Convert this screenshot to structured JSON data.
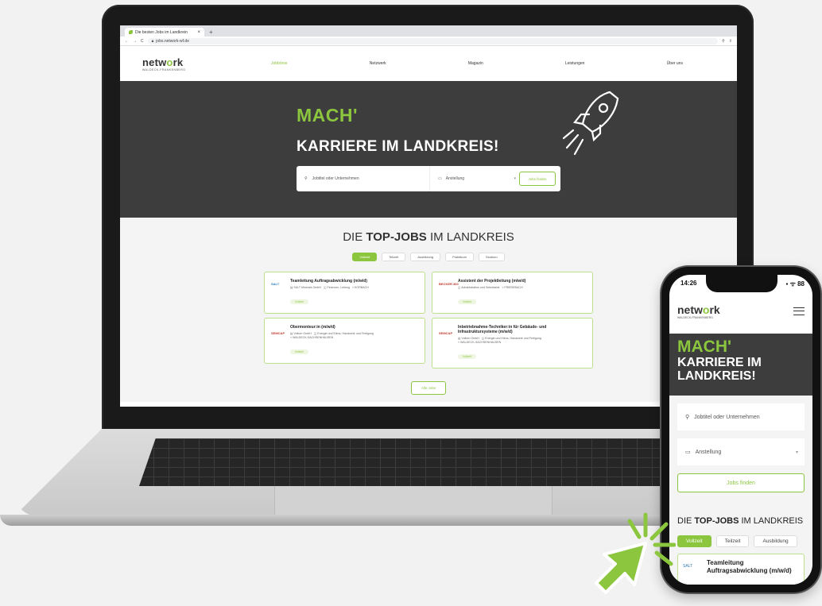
{
  "browser": {
    "tab_title": "Die besten Jobs im Landkrein",
    "tab_close": "×",
    "new_tab": "+",
    "url": "jobs.network-wf.de"
  },
  "site": {
    "logo_main_a": "netw",
    "logo_main_o": "o",
    "logo_main_b": "rk",
    "logo_sub": "WALDECK-FRANKENBERG",
    "nav": [
      "Jobbörse",
      "Netzwerk",
      "Magazin",
      "Leistungen",
      "Über uns"
    ]
  },
  "hero": {
    "mach": "MACH'",
    "title": "KARRIERE IM LANDKREIS!",
    "search_placeholder": "Jobtitel oder Unternehmen",
    "select_value": "Anstellung",
    "button": "Jobs finden"
  },
  "jobs": {
    "title_a": "DIE ",
    "title_b": "TOP-JOBS",
    "title_c": " IM LANDKREIS",
    "filters": [
      "Vollzeit",
      "Teilzeit",
      "Ausbildung",
      "Praktikum",
      "Studium"
    ],
    "cards": [
      {
        "logo": "SALT",
        "title": "Teamleitung Auftragsabwicklung (m/w/d)",
        "meta1": "SALT Minerals GmbH",
        "meta2": "Finanzen, Leitung",
        "meta3": "KORBACH",
        "tag": "Vollzeit"
      },
      {
        "logo": "BECKER 360",
        "title": "Assistent der Projektleitung (m/w/d)",
        "meta1": "Administration und Sekretariat",
        "meta2": "FRIEDEBACH",
        "meta3": "",
        "tag": "Vollzeit"
      },
      {
        "logo": "SEMCAP",
        "title": "Obermonteur:in (m/w/d)",
        "meta1": "Voltum GmbH",
        "meta2": "Energie und Klima, Handwerk und Fertigung",
        "meta3": "WALDECK-SACHSENHAUSEN",
        "tag": "Vollzeit"
      },
      {
        "logo": "SEMCAP",
        "title": "Inbetriebnahme-Techniker:in für Gebäude- und Infrastruktursysteme (m/w/d)",
        "meta1": "Voltum GmbH",
        "meta2": "Energie und Klima, Handwerk und Fertigung",
        "meta3": "WALDECK-SACHSENHAUSEN",
        "tag": "Vollzeit"
      }
    ],
    "all_jobs": "Alle Jobs"
  },
  "phone": {
    "time": "14:26",
    "status_right": "▪︎ ᯤ 88",
    "mach": "MACH'",
    "title_line1": "KARRIERE IM",
    "title_line2": "LANDKREIS!",
    "search_placeholder": "Jobtitel oder Unternehmen",
    "select_value": "Anstellung",
    "button": "Jobs finden",
    "jobs_title_a": "DIE ",
    "jobs_title_b": "TOP-JOBS",
    "jobs_title_c": " IM LANDKREIS",
    "chips": [
      "Vollzeit",
      "Teilzeit",
      "Ausbildung"
    ],
    "card_logo": "SALT",
    "card_title": "Teamleitung Auftragsabwicklung (m/w/d)"
  },
  "colors": {
    "accent": "#8cc63f",
    "hero_bg": "#3d3d3d"
  }
}
